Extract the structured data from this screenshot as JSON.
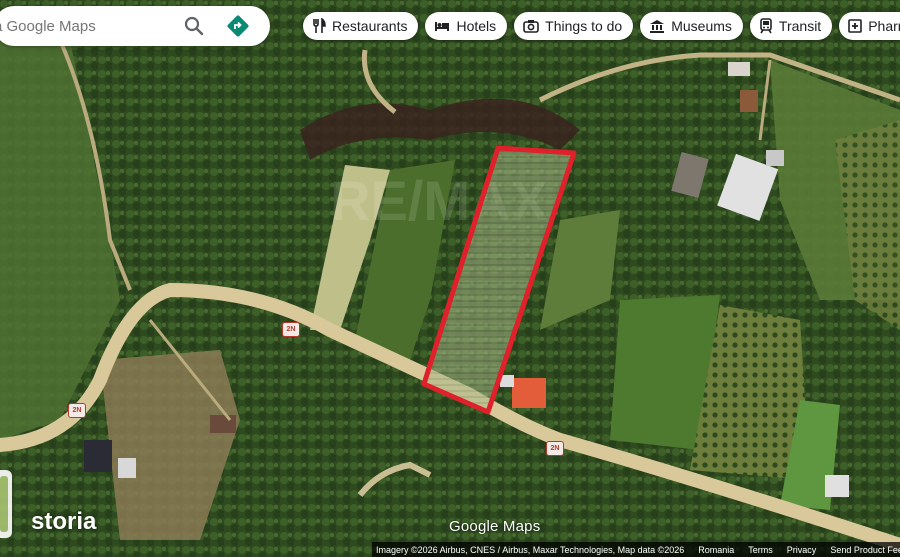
{
  "search": {
    "placeholder": "a Google Maps"
  },
  "chips": [
    {
      "label": "Restaurants",
      "icon": "fork-knife-icon"
    },
    {
      "label": "Hotels",
      "icon": "bed-icon"
    },
    {
      "label": "Things to do",
      "icon": "camera-icon"
    },
    {
      "label": "Museums",
      "icon": "museum-icon"
    },
    {
      "label": "Transit",
      "icon": "train-icon"
    },
    {
      "label": "Pharm",
      "icon": "pharmacy-icon"
    }
  ],
  "road_label": "2N",
  "watermark": {
    "storia": "storia",
    "google": "Google Maps"
  },
  "footer": {
    "attribution": "Imagery ©2026 Airbus, CNES / Airbus, Maxar Technologies, Map data ©2026",
    "country": "Romania",
    "terms": "Terms",
    "privacy": "Privacy",
    "feedback": "Send Product Feedback"
  },
  "colors": {
    "plot_outline": "#e0202a",
    "road": "#d9c99a"
  }
}
